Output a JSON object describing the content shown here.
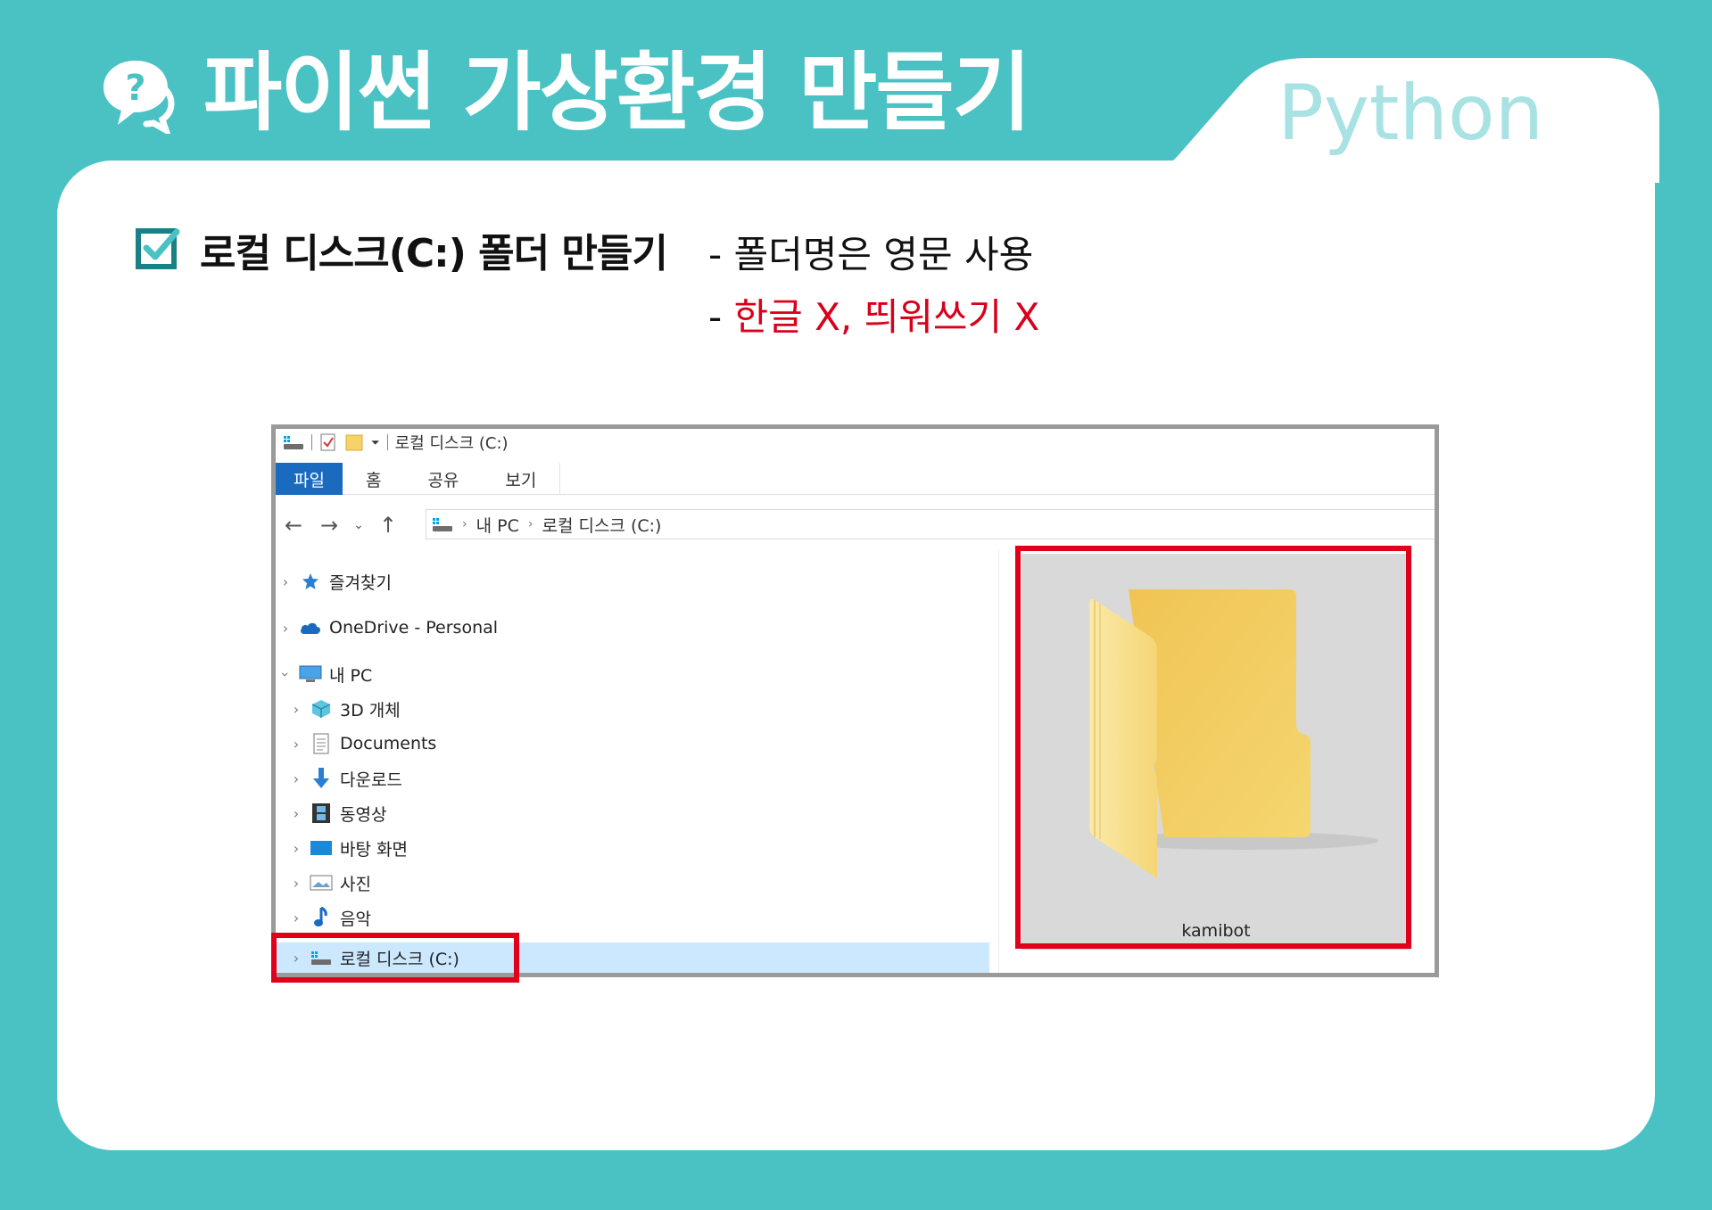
{
  "header": {
    "title": "파이썬 가상환경 만들기",
    "tag": "Python"
  },
  "subtitle": {
    "heading": "로컬 디스크(C:)  폴더 만들기",
    "note1": "- 폴더명은 영문 사용",
    "note2_prefix": "- ",
    "note2_red": "한글 X,  띄워쓰기 X"
  },
  "explorer": {
    "window_title": "로컬 디스크 (C:)",
    "ribbon_tabs": [
      "파일",
      "홈",
      "공유",
      "보기"
    ],
    "breadcrumb": [
      "내 PC",
      "로컬 디스크 (C:)"
    ],
    "tree": [
      {
        "label": "즐겨찾기",
        "icon": "star-icon"
      },
      {
        "label": "OneDrive - Personal",
        "icon": "cloud-icon"
      },
      {
        "label": "내 PC",
        "icon": "computer-icon"
      },
      {
        "label": "3D 개체",
        "icon": "cube-icon"
      },
      {
        "label": "Documents",
        "icon": "document-icon"
      },
      {
        "label": "다운로드",
        "icon": "download-arrow-icon"
      },
      {
        "label": "동영상",
        "icon": "film-icon"
      },
      {
        "label": "바탕 화면",
        "icon": "desktop-icon"
      },
      {
        "label": "사진",
        "icon": "picture-icon"
      },
      {
        "label": "음악",
        "icon": "music-note-icon"
      },
      {
        "label": "로컬 디스크 (C:)",
        "icon": "drive-icon"
      }
    ],
    "folder_name": "kamibot"
  },
  "colors": {
    "background": "#4ac2c4",
    "highlight": "#e0001b",
    "ribbon_active": "#1a6ac0",
    "selection": "#cce8ff"
  }
}
